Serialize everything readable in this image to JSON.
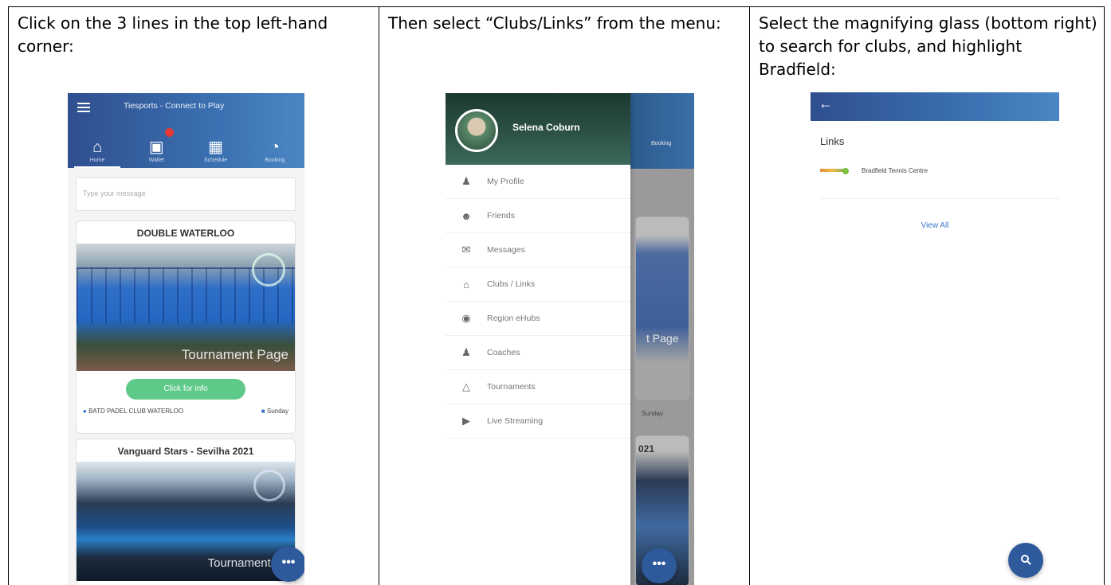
{
  "steps": [
    {
      "instruction": "Click on the 3 lines in the top left-hand corner:"
    },
    {
      "instruction": "Then select “Clubs/Links” from the menu:"
    },
    {
      "instruction": "Select the magnifying glass (bottom right) to search for clubs, and highlight Bradfield:"
    }
  ],
  "phone1": {
    "app_title": "Tiesports - Connect to Play",
    "tabs": [
      {
        "label": "Home",
        "icon": "home-icon"
      },
      {
        "label": "Wallet",
        "icon": "wallet-icon"
      },
      {
        "label": "Schedule",
        "icon": "calendar-icon"
      },
      {
        "label": "Booking",
        "icon": "booking-icon"
      }
    ],
    "message_placeholder": "Type your message",
    "card1": {
      "title": "DOUBLE WATERLOO",
      "overlay": "Tournament Page",
      "button": "Click for info",
      "location": "BATD PADEL CLUB WATERLOO",
      "day": "Sunday"
    },
    "card2": {
      "title": "Vanguard Stars - Sevilha 2021",
      "overlay": "Tournament P"
    },
    "fab": "•••"
  },
  "phone2": {
    "user_name": "Selena Coburn",
    "menu": [
      {
        "label": "My Profile",
        "icon": "person-icon"
      },
      {
        "label": "Friends",
        "icon": "friends-icon"
      },
      {
        "label": "Messages",
        "icon": "messages-icon"
      },
      {
        "label": "Clubs / Links",
        "icon": "club-icon"
      },
      {
        "label": "Region eHubs",
        "icon": "location-pin-icon"
      },
      {
        "label": "Coaches",
        "icon": "coach-icon"
      },
      {
        "label": "Tournaments",
        "icon": "tournament-icon"
      },
      {
        "label": "Live Streaming",
        "icon": "video-icon"
      }
    ],
    "behind": {
      "tab": "Booking",
      "page_text": "t Page",
      "day": "Sunday",
      "card_title": "021"
    },
    "fab": "•••"
  },
  "phone3": {
    "back_icon": "←",
    "section_title": "Links",
    "club": "Bradfield Tennis Centre",
    "view_all": "View All",
    "fab_icon": "search-icon"
  }
}
